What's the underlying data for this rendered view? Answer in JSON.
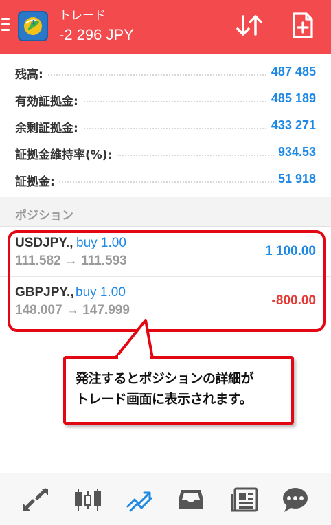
{
  "header": {
    "title": "トレード",
    "profit": "-2 296 JPY",
    "background": "#f24a4d"
  },
  "summary": [
    {
      "label": "残高:",
      "value": "487 485"
    },
    {
      "label": "有効証拠金:",
      "value": "485 189"
    },
    {
      "label": "余剰証拠金:",
      "value": "433 271"
    },
    {
      "label": "証拠金維持率(%):",
      "value": "934.53"
    },
    {
      "label": "証拠金:",
      "value": "51 918"
    }
  ],
  "positions_section": {
    "title": "ポジション"
  },
  "positions": [
    {
      "symbol": "USDJPY.,",
      "type": "buy 1.00",
      "prices": "111.582 → 111.593",
      "profit": "1 100.00"
    },
    {
      "symbol": "GBPJPY.,",
      "type": "buy 1.00",
      "prices": "148.007 → 147.999",
      "profit": "-800.00"
    }
  ],
  "callout": {
    "line1": "発注するとポジションの詳細が",
    "line2": "トレード画面に表示されます。"
  },
  "bottom_nav": [
    "quotes-icon",
    "chart-icon",
    "trade-icon",
    "history-icon",
    "news-icon",
    "chat-icon"
  ],
  "colors": {
    "accent": "#1e88e5",
    "negative": "#e53935",
    "highlight": "#e30613"
  }
}
